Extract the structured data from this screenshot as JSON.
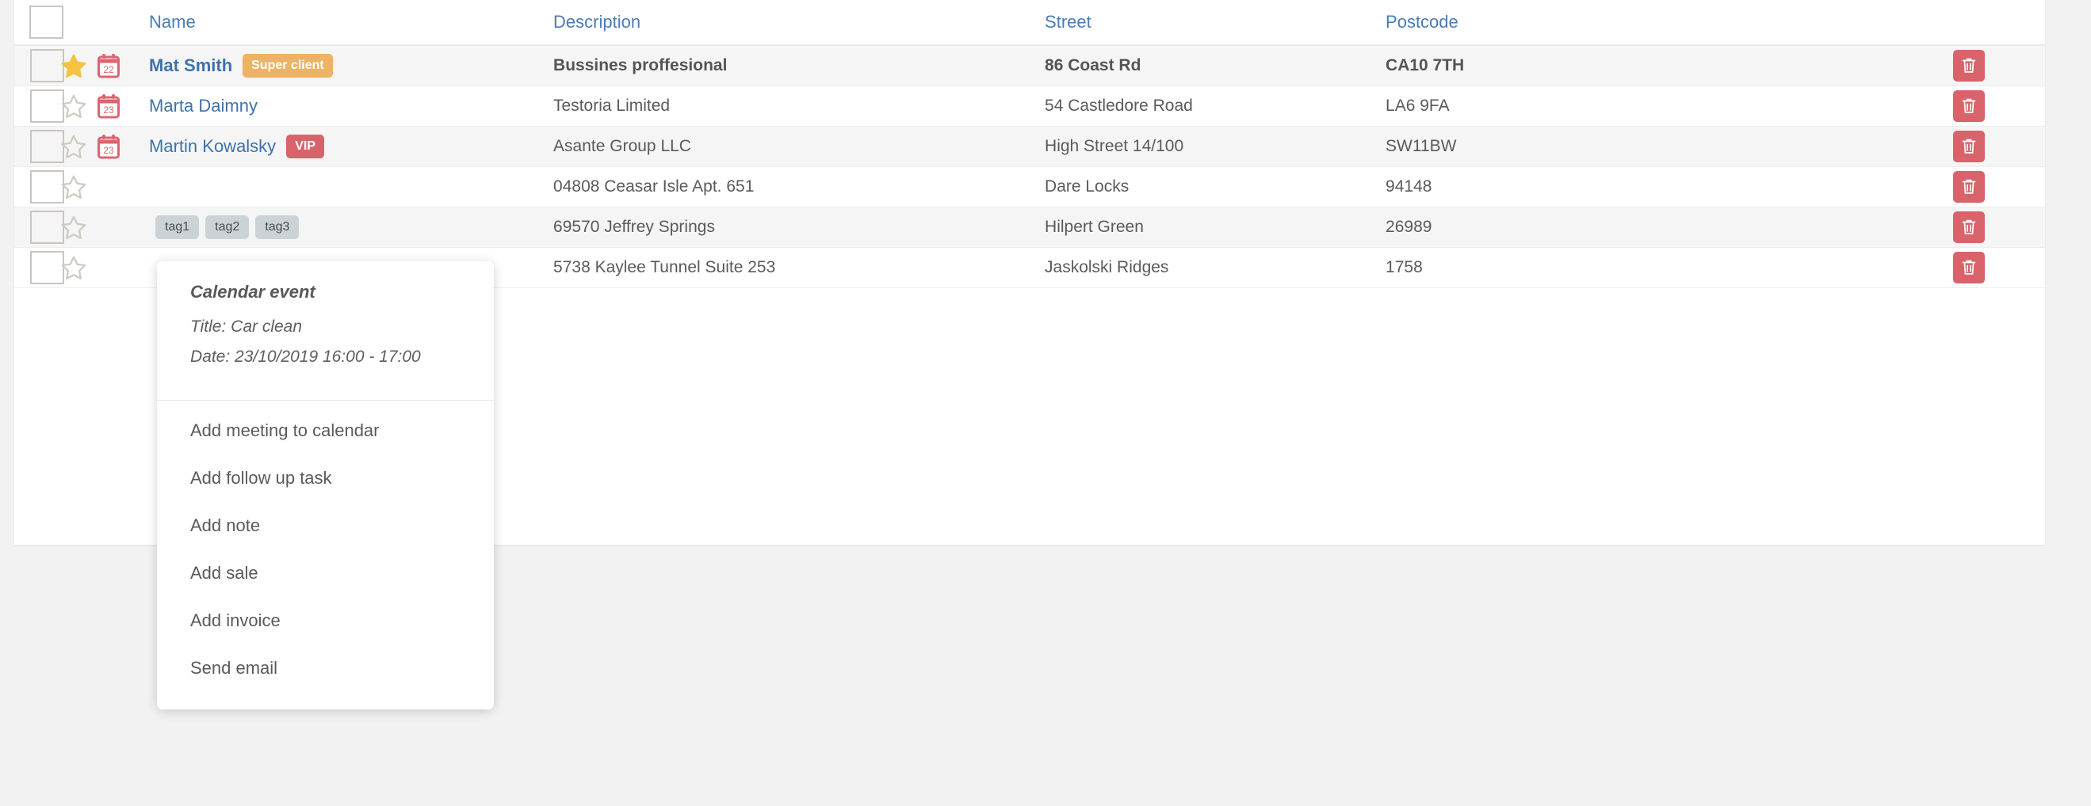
{
  "table": {
    "headers": {
      "select_all": "",
      "name": "Name",
      "description": "Description",
      "street": "Street",
      "postcode": "Postcode"
    },
    "rows": [
      {
        "name": "Mat Smith",
        "badge": "Super client",
        "badge_type": "super",
        "calendar_day": "22",
        "starred": true,
        "description": "Bussines proffesional",
        "street": "86 Coast Rd",
        "postcode": "CA10 7TH",
        "delete_label": "trash-icon",
        "tags": []
      },
      {
        "name": "Marta Daimny",
        "badge": "",
        "badge_type": "",
        "calendar_day": "23",
        "starred": false,
        "description": "Testoria Limited",
        "street": "54 Castledore Road",
        "postcode": "LA6 9FA",
        "delete_label": "trash-icon",
        "tags": []
      },
      {
        "name": "Martin Kowalsky",
        "badge": "VIP",
        "badge_type": "vip",
        "calendar_day": "23",
        "starred": false,
        "description": "Asante Group LLC",
        "street": "High Street 14/100",
        "postcode": "SW11BW",
        "delete_label": "trash-icon",
        "tags": []
      },
      {
        "name": "",
        "badge": "",
        "badge_type": "",
        "calendar_day": "",
        "starred": false,
        "description": "04808 Ceasar Isle Apt. 651",
        "street": "Dare Locks",
        "postcode": "94148",
        "delete_label": "trash-icon",
        "tags": []
      },
      {
        "name": "",
        "badge": "",
        "badge_type": "",
        "calendar_day": "",
        "starred": false,
        "description": "69570 Jeffrey Springs",
        "street": "Hilpert Green",
        "postcode": "26989",
        "delete_label": "trash-icon",
        "tags": [
          "tag1",
          "tag2",
          "tag3"
        ]
      },
      {
        "name": "",
        "badge": "",
        "badge_type": "",
        "calendar_day": "",
        "starred": false,
        "description": "5738 Kaylee Tunnel Suite 253",
        "street": "Jaskolski Ridges",
        "postcode": "1758",
        "delete_label": "trash-icon",
        "tags": []
      }
    ]
  },
  "popup": {
    "title": "Calendar event",
    "event_title": "Title: Car clean",
    "event_date": "Date: 23/10/2019 16:00 - 17:00",
    "items": [
      "Add meeting to calendar",
      "Add follow up task",
      "Add note",
      "Add sale",
      "Add invoice",
      "Send email"
    ]
  },
  "colors": {
    "link": "#3d72ab",
    "badge_super": "#edb265",
    "badge_vip": "#d9636b",
    "delete": "#d9636b",
    "star_active": "#f5c343",
    "calendar": "#dd6570",
    "tag_bg": "#ccd3d6"
  }
}
